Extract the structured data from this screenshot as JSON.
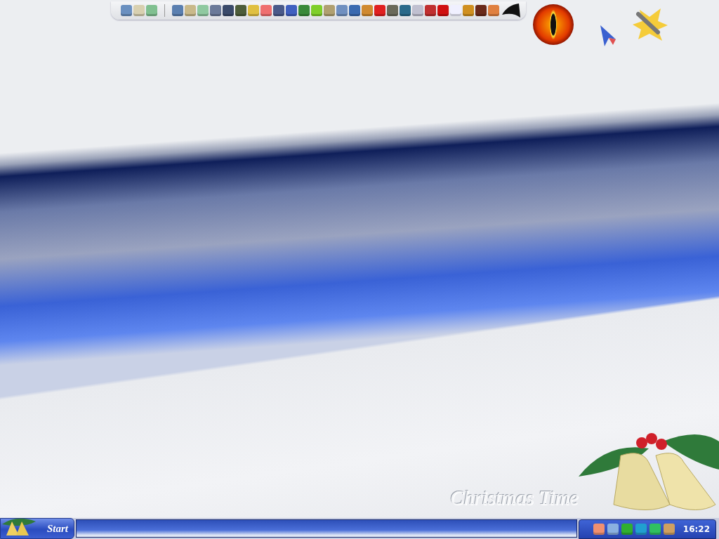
{
  "wallpaper": {
    "caption": "Christmas Time"
  },
  "taskbar": {
    "start_label": "Start",
    "clock": "16:22"
  }
}
